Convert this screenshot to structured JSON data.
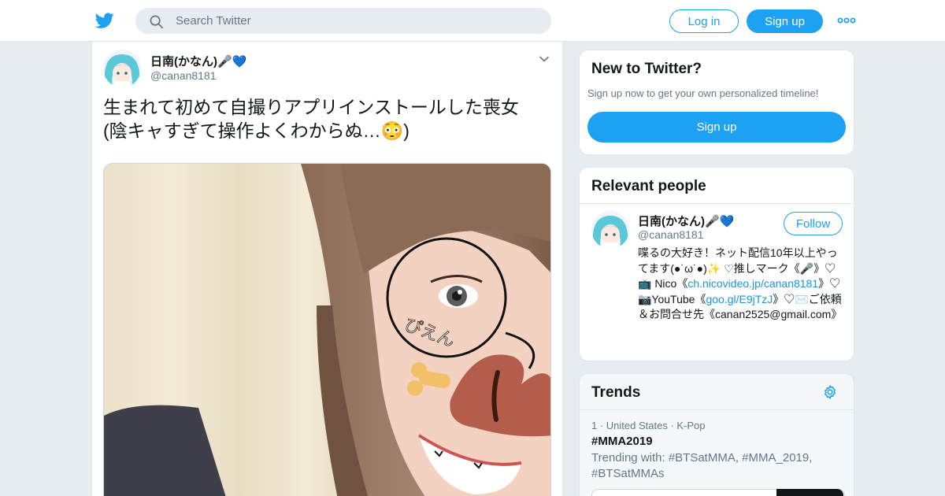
{
  "topbar": {
    "search_placeholder": "Search Twitter",
    "login_label": "Log in",
    "signup_label": "Sign up"
  },
  "tweet": {
    "author_name": "日南(かなん)🎤💙",
    "author_handle": "@canan8181",
    "text_line1": "生まれて初めて自撮りアプリインストールした喪女",
    "text_line2": "(陰キャすぎて操作よくわからぬ…😳)",
    "photo_sticker_text": "ぴえん"
  },
  "new_to_twitter": {
    "title": "New to Twitter?",
    "subtitle": "Sign up now to get your own personalized timeline!",
    "signup_label": "Sign up"
  },
  "relevant_people": {
    "title": "Relevant people",
    "person": {
      "name": "日南(かなん)🎤💙",
      "handle": "@canan8181",
      "follow_label": "Follow",
      "bio_part1": "喋るの大好き！ネット配信10年以上やってます(●˙ω˙●)✨ ♡推しマーク《🎤》♡📺 Nico《",
      "bio_link1": "ch.nicovideo.jp/canan8181",
      "bio_part2": "》♡📷YouTube《",
      "bio_link2": "goo.gl/E9jTzJ",
      "bio_part3": "》♡✉️ご依頼＆お問合せ先《canan2525@gmail.com》"
    }
  },
  "trends": {
    "title": "Trends",
    "items": [
      {
        "meta": "1 · United States · K-Pop",
        "name": "#MMA2019",
        "trending_with": "Trending with: #BTSatMMA, #MMA_2019, #BTSatMMAs"
      }
    ]
  },
  "colors": {
    "brand": "#1da1f2",
    "background": "#e6ecf0",
    "secondary_text": "#657786",
    "link": "#1b95e0"
  },
  "icons": [
    "twitter-logo-icon",
    "search-icon",
    "more-dots-icon",
    "chevron-down-icon",
    "gear-icon"
  ]
}
